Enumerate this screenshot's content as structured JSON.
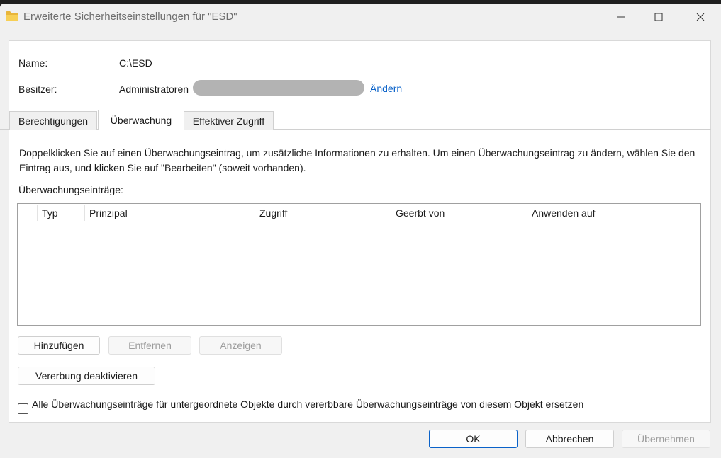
{
  "window": {
    "title": "Erweiterte Sicherheitseinstellungen für \"ESD\""
  },
  "info": {
    "name_label": "Name:",
    "name_value": "C:\\ESD",
    "owner_label": "Besitzer:",
    "owner_value": "Administratoren",
    "owner_change_link": "Ändern"
  },
  "tabs": [
    {
      "label": "Berechtigungen"
    },
    {
      "label": "Überwachung"
    },
    {
      "label": "Effektiver Zugriff"
    }
  ],
  "description": "Doppelklicken Sie auf einen Überwachungseintrag, um zusätzliche Informationen zu erhalten. Um einen Überwachungseintrag zu ändern, wählen Sie den Eintrag aus, und klicken Sie auf \"Bearbeiten\" (soweit vorhanden).",
  "entries_label": "Überwachungseinträge:",
  "table": {
    "columns": [
      "Typ",
      "Prinzipal",
      "Zugriff",
      "Geerbt von",
      "Anwenden auf"
    ],
    "rows": []
  },
  "buttons": {
    "add": "Hinzufügen",
    "remove": "Entfernen",
    "view": "Anzeigen",
    "disable_inheritance": "Vererbung deaktivieren",
    "ok": "OK",
    "cancel": "Abbrechen",
    "apply": "Übernehmen"
  },
  "replace_checkbox": {
    "label": "Alle Überwachungseinträge für untergeordnete Objekte durch vererbbare Überwachungseinträge von diesem Objekt ersetzen",
    "checked": false
  },
  "colors": {
    "accent": "#0a62c9",
    "folder_icon": "#f4c542"
  }
}
